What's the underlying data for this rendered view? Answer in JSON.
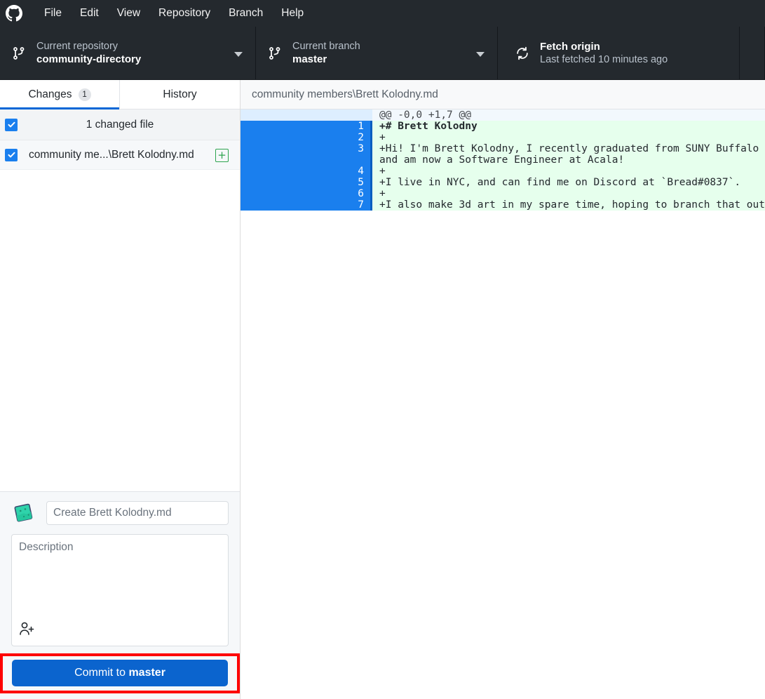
{
  "menubar": {
    "logo_icon": "github-logo-icon",
    "items": [
      {
        "label": "File"
      },
      {
        "label": "Edit"
      },
      {
        "label": "View"
      },
      {
        "label": "Repository"
      },
      {
        "label": "Branch"
      },
      {
        "label": "Help"
      }
    ]
  },
  "toolbar": {
    "repository": {
      "icon": "repo-branch-icon",
      "label": "Current repository",
      "value": "community-directory",
      "caret_icon": "chevron-down-icon"
    },
    "branch": {
      "icon": "branch-icon",
      "label": "Current branch",
      "value": "master",
      "caret_icon": "chevron-down-icon"
    },
    "fetch": {
      "icon": "sync-icon",
      "title": "Fetch origin",
      "subtitle": "Last fetched 10 minutes ago"
    }
  },
  "sidebar": {
    "tabs": [
      {
        "label": "Changes",
        "badge": "1",
        "active": true
      },
      {
        "label": "History",
        "badge": "",
        "active": false
      }
    ],
    "changed_header": {
      "text": "1 changed file",
      "checkbox_checked": true
    },
    "files": [
      {
        "name": "community me...\\Brett Kolodny.md",
        "checkbox_checked": true,
        "status": "+",
        "status_name": "new-file"
      }
    ]
  },
  "commit": {
    "avatar_icon": "user-avatar",
    "summary_placeholder": "Create Brett Kolodny.md",
    "summary_value": "",
    "description_placeholder": "Description",
    "description_value": "",
    "coauthor_icon": "add-coauthor-icon",
    "button_prefix": "Commit to ",
    "button_branch": "master",
    "highlight_color": "#fe0000",
    "button_color": "#0b64ce"
  },
  "diff": {
    "file_path": "community members\\Brett Kolodny.md",
    "lines": [
      {
        "type": "hunk",
        "old": "",
        "new": "",
        "code": "@@ -0,0 +1,7 @@"
      },
      {
        "type": "add",
        "old": "",
        "new": "1",
        "code": "+# Brett Kolodny",
        "style": "md-h1",
        "plain_prefix": "+"
      },
      {
        "type": "add",
        "old": "",
        "new": "2",
        "code": "+"
      },
      {
        "type": "add",
        "old": "",
        "new": "3",
        "code": "+Hi! I'm Brett Kolodny, I recently graduated from SUNY Buffalo\nand am now a Software Engineer at Acala!"
      },
      {
        "type": "add",
        "old": "",
        "new": "4",
        "code": "+"
      },
      {
        "type": "add",
        "old": "",
        "new": "5",
        "code": "+I live in NYC, and can find me on Discord at `Bread#0837`."
      },
      {
        "type": "add",
        "old": "",
        "new": "6",
        "code": "+"
      },
      {
        "type": "add",
        "old": "",
        "new": "7",
        "code": "+I also make 3d art in my spare time, hoping to branch that out"
      }
    ]
  },
  "colors": {
    "toolbar_bg": "#24292e",
    "accent_blue": "#0366d6",
    "add_green_bg": "#e6ffed",
    "gutter_blue": "#1a7fee"
  }
}
